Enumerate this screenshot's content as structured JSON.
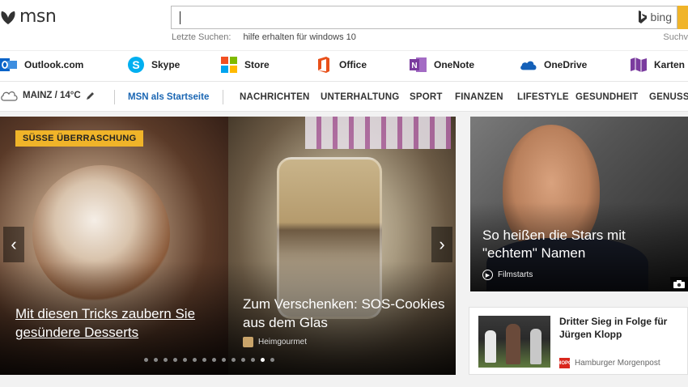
{
  "header": {
    "logo_text": "msn",
    "search": {
      "value": "",
      "placeholder": "",
      "engine_label": "bing"
    },
    "recent_label": "Letzte Suchen:",
    "recent_query": "hilfe erhalten für windows 10",
    "search_options_label": "Suchv",
    "accent_color": "#f0b429"
  },
  "apps": [
    {
      "label": "Outlook.com",
      "icon": "outlook-icon",
      "color": "#0a64c8"
    },
    {
      "label": "Skype",
      "icon": "skype-icon",
      "color": "#00aff0"
    },
    {
      "label": "Store",
      "icon": "store-icon",
      "color": "#f25022"
    },
    {
      "label": "Office",
      "icon": "office-icon",
      "color": "#e8501a"
    },
    {
      "label": "OneNote",
      "icon": "onenote-icon",
      "color": "#7a3b9e"
    },
    {
      "label": "OneDrive",
      "icon": "onedrive-icon",
      "color": "#1460b8"
    },
    {
      "label": "Karten",
      "icon": "maps-icon",
      "color": "#7a3b9e"
    }
  ],
  "nav": {
    "weather": "MAINZ / 14°C",
    "startpage": "MSN als Startseite",
    "items": [
      "NACHRICHTEN",
      "UNTERHALTUNG",
      "SPORT",
      "FINANZEN",
      "LIFESTYLE",
      "GESUNDHEIT",
      "GENUSS"
    ]
  },
  "carousel": {
    "badge": "SÜSSE ÜBERRASCHUNG",
    "slide1_title": "Mit diesen Tricks zaubern Sie gesündere Desserts",
    "slide2_title": "Zum Verschenken: SOS-Cookies aus dem Glas",
    "slide2_source": "Heimgourmet",
    "dot_count": 14,
    "active_dot": 13
  },
  "feature": {
    "title": "So heißen die Stars mit \"echtem\" Namen",
    "source": "Filmstarts"
  },
  "news": {
    "title": "Dritter Sieg in Folge für Jürgen Klopp",
    "source": "Hamburger Morgenpost",
    "source_badge": "MOPO"
  }
}
